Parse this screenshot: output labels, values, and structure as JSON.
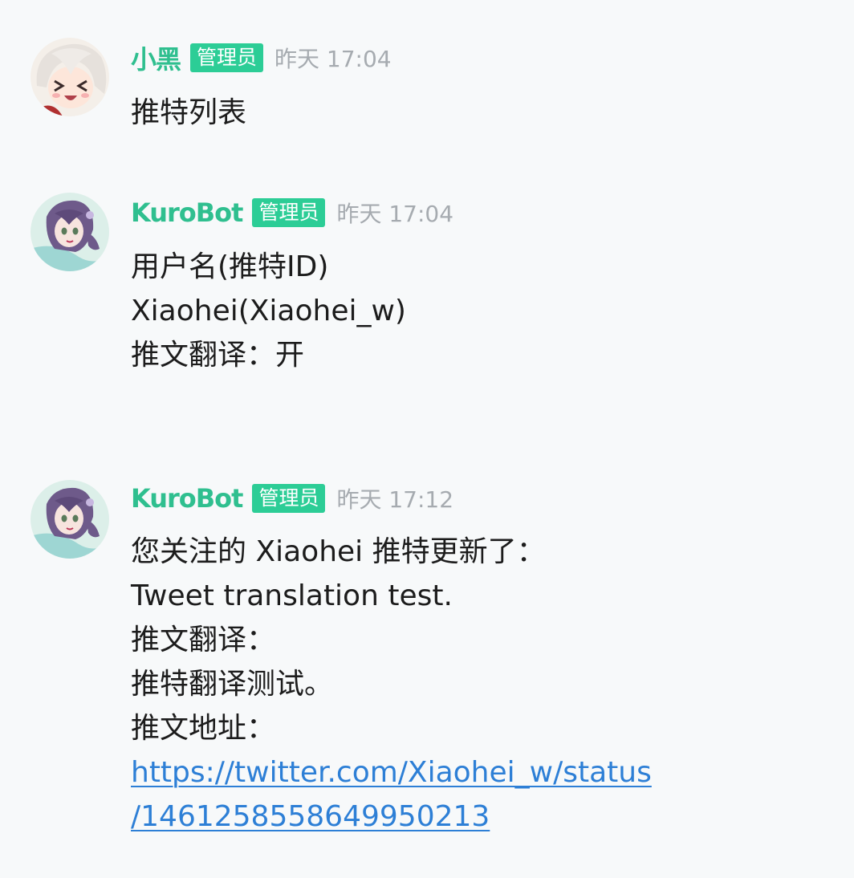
{
  "colors": {
    "accent": "#2fbf8f",
    "badge_bg": "#2ccd96",
    "link": "#2d7fd6",
    "timestamp": "#a6abb0",
    "background": "#f7f9fa"
  },
  "messages": [
    {
      "username": "小黑",
      "badge": "管理员",
      "timestamp": "昨天 17:04",
      "avatar": "anime-girl-white-hair-avatar",
      "lines": [
        "推特列表"
      ]
    },
    {
      "username": "KuroBot",
      "badge": "管理员",
      "timestamp": "昨天 17:04",
      "avatar": "anime-girl-purple-hair-avatar",
      "lines": [
        "用户名(推特ID)",
        "Xiaohei(Xiaohei_w)",
        "推文翻译：开"
      ]
    },
    {
      "username": "KuroBot",
      "badge": "管理员",
      "timestamp": "昨天 17:12",
      "avatar": "anime-girl-purple-hair-avatar",
      "lines": [
        "您关注的 Xiaohei 推特更新了：",
        "Tweet translation test.",
        "推文翻译：",
        "推特翻译测试。",
        "推文地址："
      ],
      "link_lines": [
        "https://twitter.com/Xiaohei_w/status",
        "/1461258558649950213"
      ]
    }
  ]
}
